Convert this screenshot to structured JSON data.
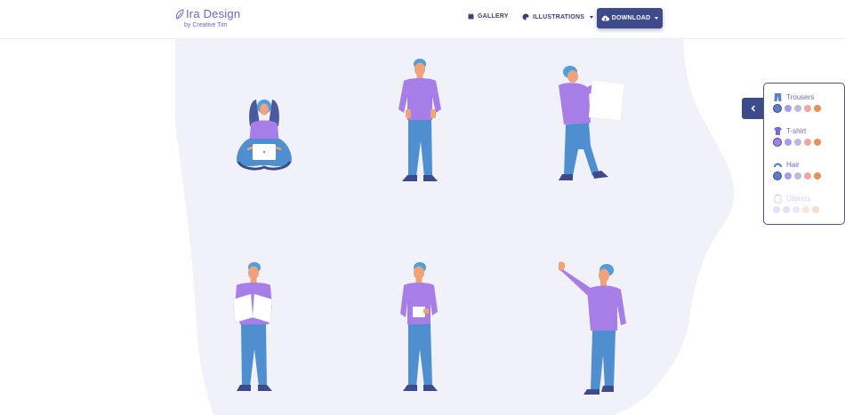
{
  "brand": {
    "title": "Ira Design",
    "subtitle": "by Creative Tim"
  },
  "nav": {
    "gallery_label": "GALLERY",
    "illustrations_label": "ILLUSTRATIONS",
    "download_label": "DOWNLOAD"
  },
  "panel": {
    "options": [
      {
        "label": "Trousers",
        "icon": "trousers-icon",
        "disabled": false
      },
      {
        "label": "T-shirt",
        "icon": "tshirt-icon",
        "disabled": false
      },
      {
        "label": "Hair",
        "icon": "hair-icon",
        "disabled": false
      },
      {
        "label": "Objects",
        "icon": "objects-icon",
        "disabled": true
      }
    ],
    "swatch_colors": [
      "#5b7fc7",
      "#a89be8",
      "#b8bde0",
      "#f0a7a0",
      "#e8905a"
    ]
  },
  "colors": {
    "accent": "#3d4a8c",
    "brand": "#6c66d6",
    "background_blob": "#f1f1fa",
    "shirt": "#a77ee8",
    "trousers": "#4f8fd0",
    "skin": "#f0a27a",
    "hair": "#4f9fdc"
  }
}
